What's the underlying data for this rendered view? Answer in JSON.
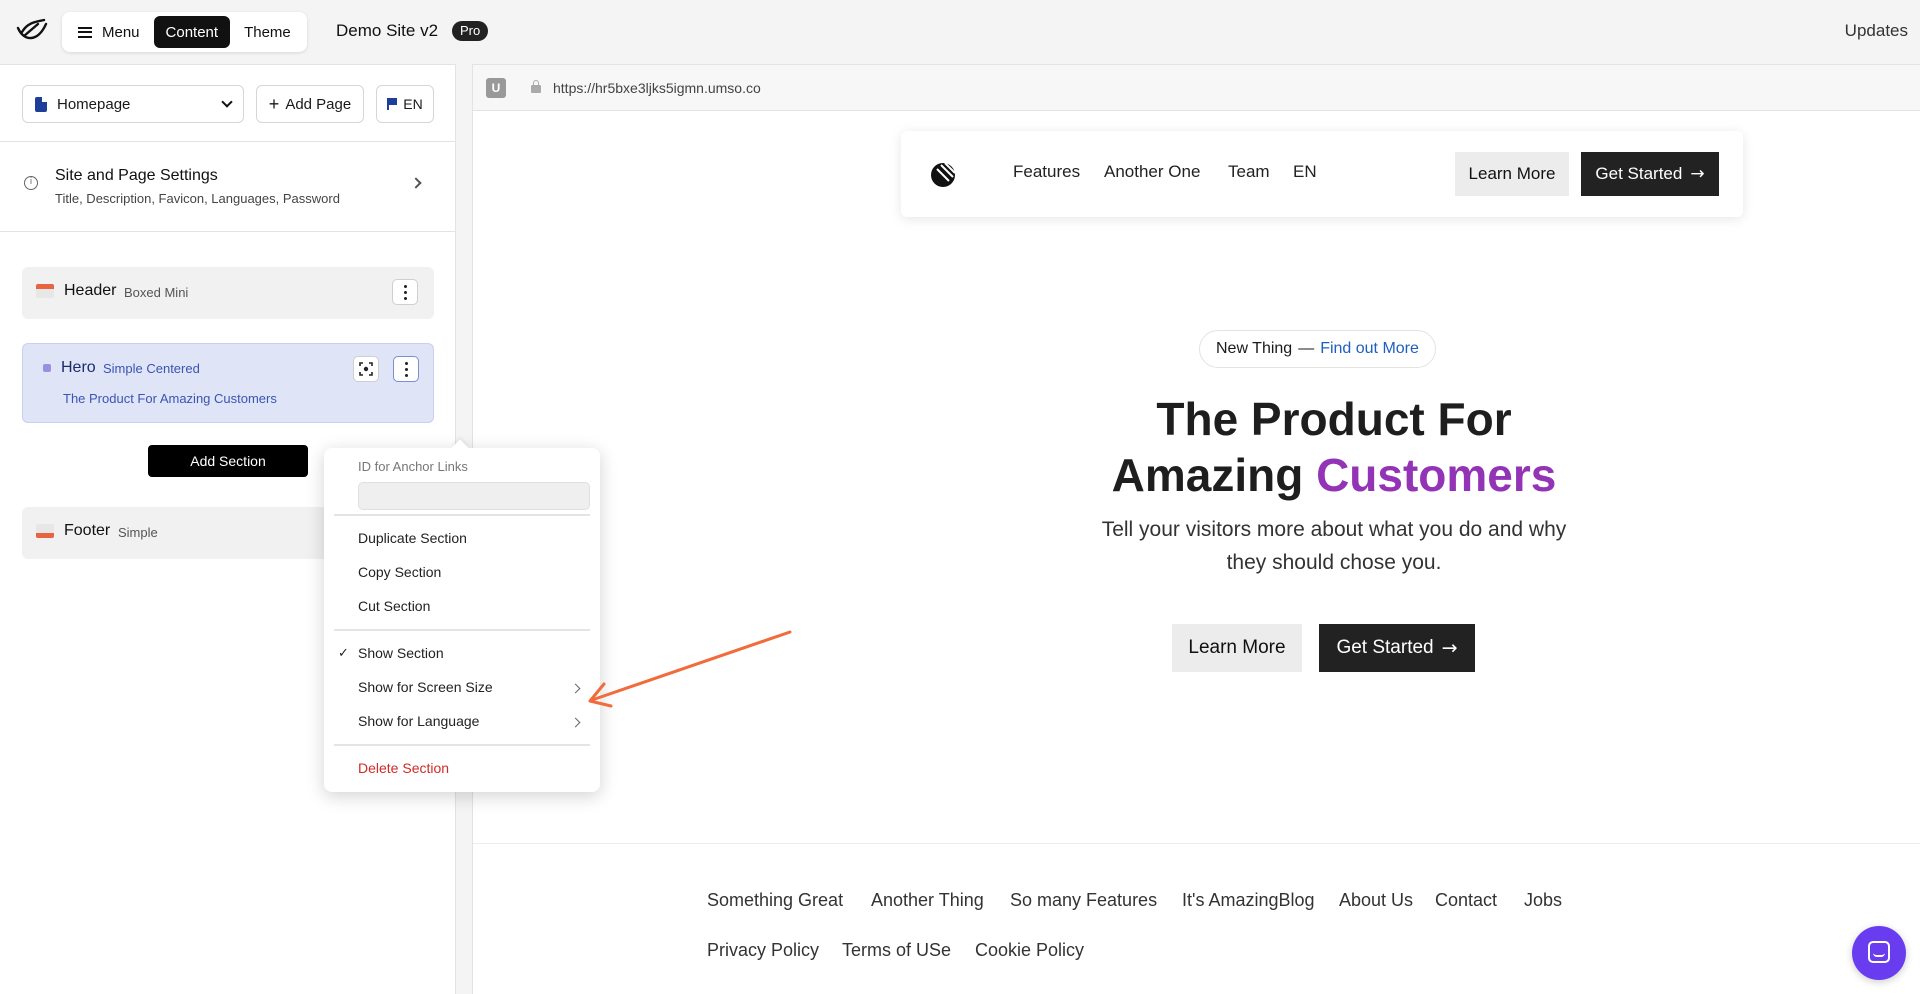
{
  "topbar": {
    "menu_label": "Menu",
    "content_label": "Content",
    "theme_label": "Theme",
    "site_name": "Demo Site v2",
    "plan_badge": "Pro",
    "updates_label": "Updates"
  },
  "sidebar": {
    "page_select": "Homepage",
    "add_page_label": "Add Page",
    "language_label": "EN",
    "settings": {
      "title": "Site and Page Settings",
      "subtitle": "Title, Description, Favicon, Languages, Password"
    },
    "sections": [
      {
        "title": "Header",
        "type": "Boxed Mini"
      },
      {
        "title": "Hero",
        "type": "Simple Centered",
        "subtitle": "The Product For Amazing Customers"
      },
      {
        "title": "Footer",
        "type": "Simple"
      }
    ],
    "add_section_label": "Add Section"
  },
  "context_menu": {
    "anchor_label": "ID for Anchor Links",
    "anchor_value": "",
    "duplicate": "Duplicate Section",
    "copy": "Copy Section",
    "cut": "Cut Section",
    "show_section": "Show Section",
    "show_section_checked": true,
    "show_screen_size": "Show for Screen Size",
    "show_language": "Show for Language",
    "delete": "Delete Section"
  },
  "preview": {
    "url": "https://hr5bxe3ljks5igmn.umso.co",
    "nav": [
      "Features",
      "Another One",
      "Team",
      "EN"
    ],
    "header_learn_more": "Learn More",
    "header_get_started": "Get Started",
    "pill_text": "New Thing",
    "pill_dash": "—",
    "pill_link": "Find out More",
    "hero_title_part1": "The Product For",
    "hero_title_part2": "Amazing",
    "hero_title_accent": "Customers",
    "hero_paragraph": "Tell your visitors more about what you do and why they should chose you.",
    "hero_learn_more": "Learn More",
    "hero_get_started": "Get Started",
    "footer_links": [
      "Something Great",
      "Another Thing",
      "So many Features",
      "It's AmazingBlog",
      "About Us",
      "Contact",
      "Jobs"
    ],
    "footer_legal": [
      "Privacy Policy",
      "Terms of USe",
      "Cookie Policy"
    ]
  },
  "colors": {
    "accent_purple": "#9333b6",
    "link_blue": "#1f5fbf",
    "delete_red": "#d12a2a",
    "annotation_arrow": "#f26b3a",
    "chat_purple": "#6a3cf0"
  }
}
